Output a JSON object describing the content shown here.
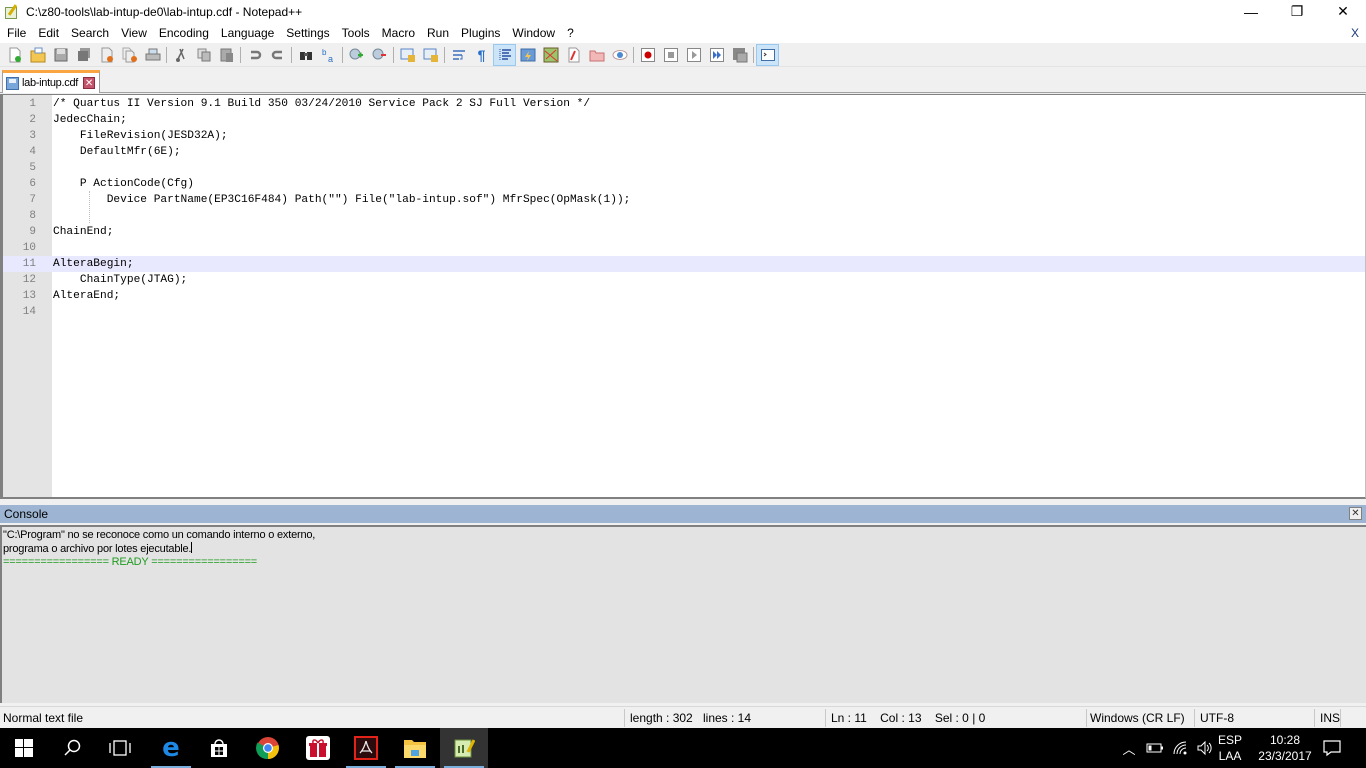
{
  "window": {
    "title": "C:\\z80-tools\\lab-intup-de0\\lab-intup.cdf - Notepad++",
    "controls": {
      "minimize": "—",
      "restore": "❐",
      "close": "✕"
    }
  },
  "menubar": {
    "items": [
      "File",
      "Edit",
      "Search",
      "View",
      "Encoding",
      "Language",
      "Settings",
      "Tools",
      "Macro",
      "Run",
      "Plugins",
      "Window",
      "?"
    ],
    "close_doc": "X"
  },
  "toolbar": {
    "buttons": [
      {
        "icon": "new-file-icon"
      },
      {
        "icon": "open-file-icon"
      },
      {
        "icon": "save-icon"
      },
      {
        "icon": "save-all-icon"
      },
      {
        "icon": "close-icon"
      },
      {
        "icon": "close-all-icon"
      },
      {
        "icon": "print-icon"
      },
      {
        "icon": "cut-icon"
      },
      {
        "icon": "copy-icon"
      },
      {
        "icon": "paste-icon"
      },
      {
        "icon": "undo-icon"
      },
      {
        "icon": "redo-icon"
      },
      {
        "icon": "find-icon"
      },
      {
        "icon": "replace-icon"
      },
      {
        "icon": "zoom-in-icon"
      },
      {
        "icon": "zoom-out-icon"
      },
      {
        "icon": "sync-vertical-icon"
      },
      {
        "icon": "sync-horizontal-icon"
      },
      {
        "icon": "word-wrap-icon"
      },
      {
        "icon": "show-all-chars-icon"
      },
      {
        "icon": "indent-guide-icon",
        "active": true
      },
      {
        "icon": "user-language-icon"
      },
      {
        "icon": "document-map-icon"
      },
      {
        "icon": "function-list-icon"
      },
      {
        "icon": "folder-as-workspace-icon"
      },
      {
        "icon": "monitoring-icon"
      },
      {
        "icon": "record-macro-icon"
      },
      {
        "icon": "stop-record-icon"
      },
      {
        "icon": "play-macro-icon"
      },
      {
        "icon": "run-macro-multiple-icon"
      },
      {
        "icon": "save-macro-icon"
      },
      {
        "icon": "console-icon",
        "active": true
      }
    ]
  },
  "tabs": [
    {
      "label": "lab-intup.cdf",
      "close": "✕",
      "active": true
    }
  ],
  "editor": {
    "current_line": 11,
    "lines": [
      "/* Quartus II Version 9.1 Build 350 03/24/2010 Service Pack 2 SJ Full Version */",
      "JedecChain;",
      "    FileRevision(JESD32A);",
      "    DefaultMfr(6E);",
      "",
      "    P ActionCode(Cfg)",
      "        Device PartName(EP3C16F484) Path(\"\") File(\"lab-intup.sof\") MfrSpec(OpMask(1));",
      "",
      "ChainEnd;",
      "",
      "AlteraBegin;",
      "    ChainType(JTAG);",
      "AlteraEnd;",
      ""
    ]
  },
  "console": {
    "title": "Console",
    "close": "✕",
    "lines": [
      "\"C:\\Program\" no se reconoce como un comando interno o externo,",
      "programa o archivo por lotes ejecutable."
    ],
    "ready_line": "================= READY =================",
    "colors": {
      "ready": "#1f9b1f",
      "header": "#9db5d2"
    }
  },
  "statusbar": {
    "file_type": "Normal text file",
    "length": "length : 302",
    "lines": "lines : 14",
    "position": "Ln : 11    Col : 13    Sel : 0 | 0",
    "eol": "Windows (CR LF)",
    "encoding": "UTF-8",
    "mode": "INS"
  },
  "taskbar": {
    "apps": [
      {
        "name": "start",
        "icon": "windows-start-icon"
      },
      {
        "name": "search",
        "icon": "search-icon"
      },
      {
        "name": "task-view",
        "icon": "task-view-icon"
      },
      {
        "name": "edge",
        "icon": "edge-icon"
      },
      {
        "name": "store",
        "icon": "store-icon"
      },
      {
        "name": "chrome",
        "icon": "chrome-icon"
      },
      {
        "name": "gift",
        "icon": "gift-icon"
      },
      {
        "name": "acrobat",
        "icon": "acrobat-icon"
      },
      {
        "name": "file-explorer",
        "icon": "folder-icon"
      },
      {
        "name": "notepad++",
        "icon": "notepadpp-icon",
        "active": true
      }
    ],
    "tray": {
      "language_top": "ESP",
      "language_bottom": "LAA",
      "time": "10:28",
      "date": "23/3/2017"
    }
  }
}
